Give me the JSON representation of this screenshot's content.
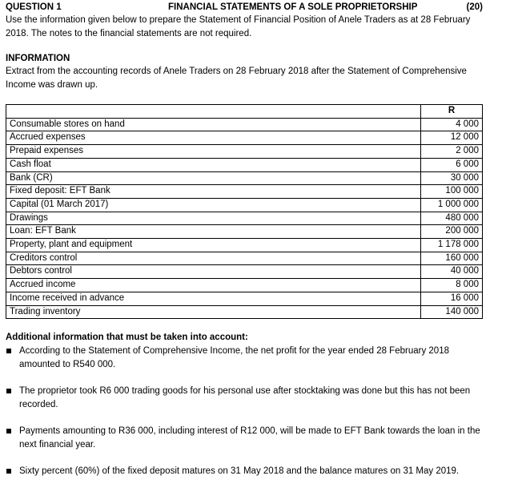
{
  "header": {
    "question_label": "QUESTION 1",
    "title": "FINANCIAL STATEMENTS OF A SOLE PROPRIETORSHIP",
    "marks": "(20)"
  },
  "intro": "Use the information given below to prepare the Statement of Financial Position of Anele Traders as at 28 February 2018.  The notes to the financial statements are not required.",
  "information": {
    "title": "INFORMATION",
    "text": "Extract from the accounting records of Anele Traders on 28 February 2018 after the Statement of Comprehensive Income was drawn up."
  },
  "table": {
    "header": {
      "label": "",
      "value": "R"
    },
    "rows": [
      {
        "label": "Consumable stores on hand",
        "value": "4 000"
      },
      {
        "label": "Accrued expenses",
        "value": "12 000"
      },
      {
        "label": "Prepaid expenses",
        "value": "2 000"
      },
      {
        "label": "Cash float",
        "value": "6 000"
      },
      {
        "label": "Bank (CR)",
        "value": "30 000"
      },
      {
        "label": "Fixed deposit: EFT Bank",
        "value": "100 000"
      },
      {
        "label": "Capital (01 March 2017)",
        "value": "1 000 000"
      },
      {
        "label": "Drawings",
        "value": "480 000"
      },
      {
        "label": "Loan: EFT Bank",
        "value": "200 000"
      },
      {
        "label": "Property, plant and equipment",
        "value": "1 178 000"
      },
      {
        "label": "Creditors control",
        "value": "160 000"
      },
      {
        "label": "Debtors control",
        "value": "40 000"
      },
      {
        "label": "Accrued income",
        "value": "8 000"
      },
      {
        "label": "Income received in advance",
        "value": "16 000"
      },
      {
        "label": "Trading inventory",
        "value": "140 000"
      }
    ]
  },
  "additional": {
    "title": "Additional information that must be taken into account:",
    "items": [
      "According to the Statement of Comprehensive Income, the net profit for the year ended 28 February 2018 amounted to R540 000.",
      "The proprietor took R6 000 trading goods for his personal use after stocktaking was done but this has not been recorded.",
      "Payments amounting to R36 000, including interest of R12 000, will be made to EFT Bank towards the loan in the next financial year.",
      "Sixty percent (60%) of the fixed deposit matures on 31 May 2018 and the balance matures on 31 May 2019."
    ]
  }
}
